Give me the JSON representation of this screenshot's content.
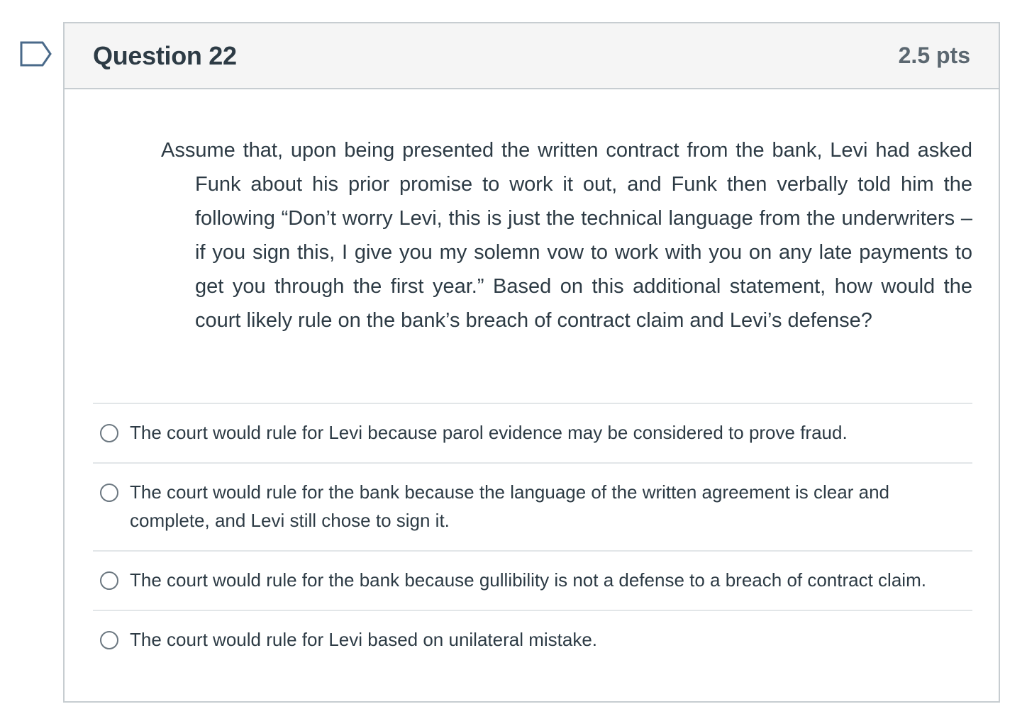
{
  "question": {
    "title": "Question 22",
    "points": "2.5 pts",
    "text": "Assume that, upon being presented the written contract from the bank, Levi had asked Funk about his prior promise to work it out, and Funk then verbally told him the following “Don’t worry Levi, this is just the technical language from the underwriters – if you sign this, I give you my solemn vow to work with you on any late payments to get you through the first year.” Based on this additional statement, how would the court likely rule on the bank’s breach of contract claim and Levi’s defense?",
    "answers": [
      {
        "label": "The court would rule for Levi because parol evidence may be considered to prove fraud."
      },
      {
        "label": "The court would rule for the bank because the language of the written agreement is clear and complete, and Levi still chose to sign it."
      },
      {
        "label": "The court would rule for the bank because gullibility is not a defense to a breach of contract claim."
      },
      {
        "label": "The court would rule for Levi based on unilateral mistake."
      }
    ]
  },
  "icons": {
    "flag": "flag-question-icon",
    "radio": "radio-unselected-icon"
  },
  "colors": {
    "flag": "#4a6a8a",
    "header_bg": "#f5f5f5",
    "border": "#c7cdd1",
    "text": "#2d3b45"
  }
}
